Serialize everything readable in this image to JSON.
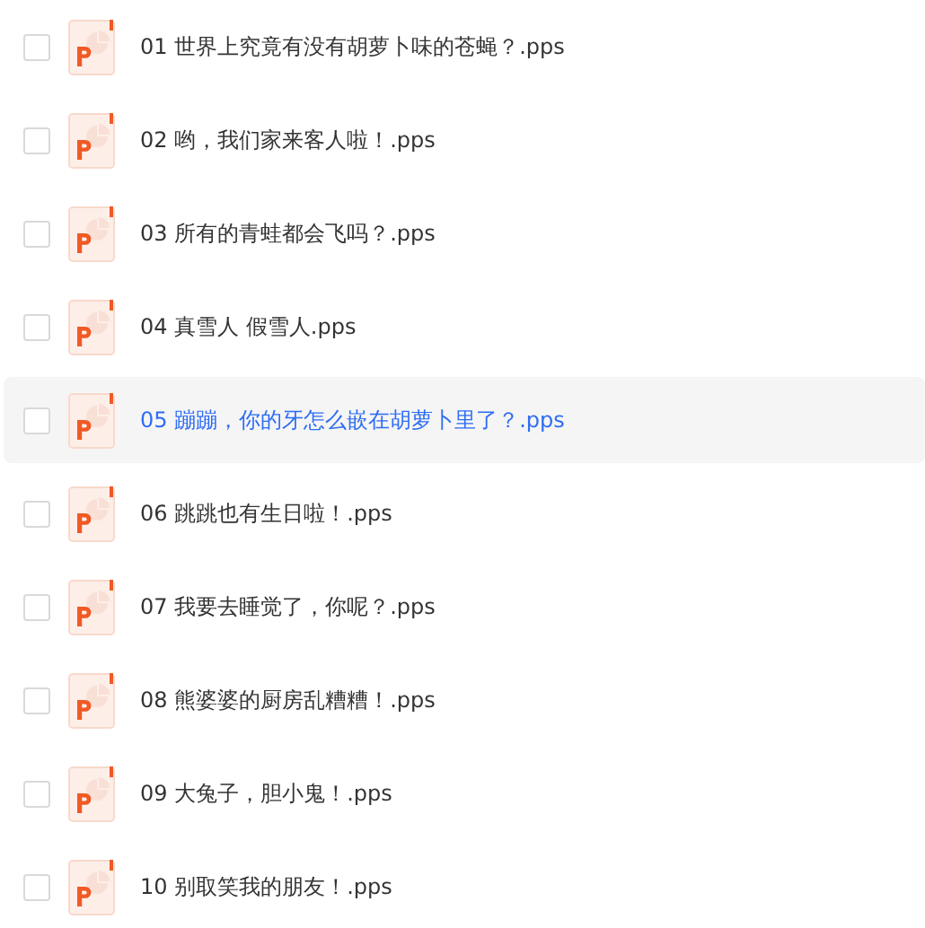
{
  "files": [
    {
      "name": "01 世界上究竟有没有胡萝卜味的苍蝇？.pps",
      "checked": false,
      "highlighted": false
    },
    {
      "name": "02 哟，我们家来客人啦！.pps",
      "checked": false,
      "highlighted": false
    },
    {
      "name": "03 所有的青蛙都会飞吗？.pps",
      "checked": false,
      "highlighted": false
    },
    {
      "name": "04 真雪人 假雪人.pps",
      "checked": false,
      "highlighted": false
    },
    {
      "name": "05 蹦蹦，你的牙怎么嵌在胡萝卜里了？.pps",
      "checked": false,
      "highlighted": true
    },
    {
      "name": "06 跳跳也有生日啦！.pps",
      "checked": false,
      "highlighted": false
    },
    {
      "name": "07 我要去睡觉了，你呢？.pps",
      "checked": false,
      "highlighted": false
    },
    {
      "name": "08 熊婆婆的厨房乱糟糟！.pps",
      "checked": false,
      "highlighted": false
    },
    {
      "name": "09 大兔子，胆小鬼！.pps",
      "checked": false,
      "highlighted": false
    },
    {
      "name": "10 别取笑我的朋友！.pps",
      "checked": false,
      "highlighted": false
    }
  ]
}
